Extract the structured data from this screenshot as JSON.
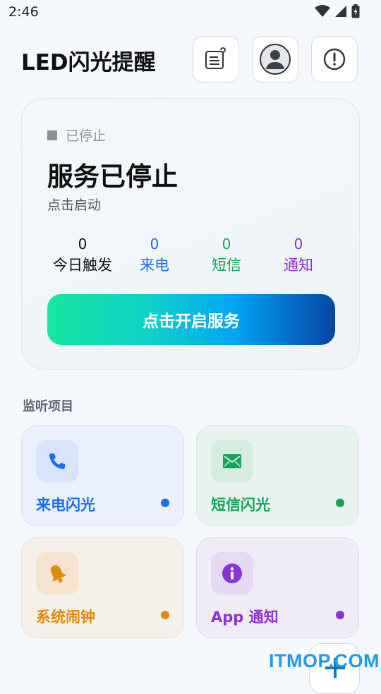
{
  "status_bar": {
    "time": "2:46"
  },
  "header": {
    "title": "LED闪光提醒"
  },
  "status_card": {
    "state_label": "已停止",
    "title": "服务已停止",
    "subtitle": "点击启动",
    "stats": [
      {
        "value": "0",
        "label": "今日触发",
        "color": "#111111"
      },
      {
        "value": "0",
        "label": "来电",
        "color": "#1a6cf0"
      },
      {
        "value": "0",
        "label": "短信",
        "color": "#14a35a"
      },
      {
        "value": "0",
        "label": "通知",
        "color": "#8b32d6"
      }
    ],
    "start_button": "点击开启服务"
  },
  "section": {
    "title": "监听项目"
  },
  "tiles": [
    {
      "label": "来电闪光",
      "color": "#1a6cf0",
      "bg": "#eaf0fc",
      "border": "#d5e1fb",
      "icon_bg": "#d7e4fb",
      "icon": "phone-icon"
    },
    {
      "label": "短信闪光",
      "color": "#14a35a",
      "bg": "#e8f3ef",
      "border": "#d6ebe1",
      "icon_bg": "#d4eddf",
      "icon": "mail-icon"
    },
    {
      "label": "系统闹钟",
      "color": "#e08a0b",
      "bg": "#f6f0ea",
      "border": "#efe3d6",
      "icon_bg": "#f6e3cd",
      "icon": "bell-icon"
    },
    {
      "label": "App 通知",
      "color": "#8b32d6",
      "bg": "#f0ecf7",
      "border": "#e2d9f1",
      "icon_bg": "#e6d9f6",
      "icon": "info-icon"
    }
  ],
  "watermark": "ITMOP.COM"
}
